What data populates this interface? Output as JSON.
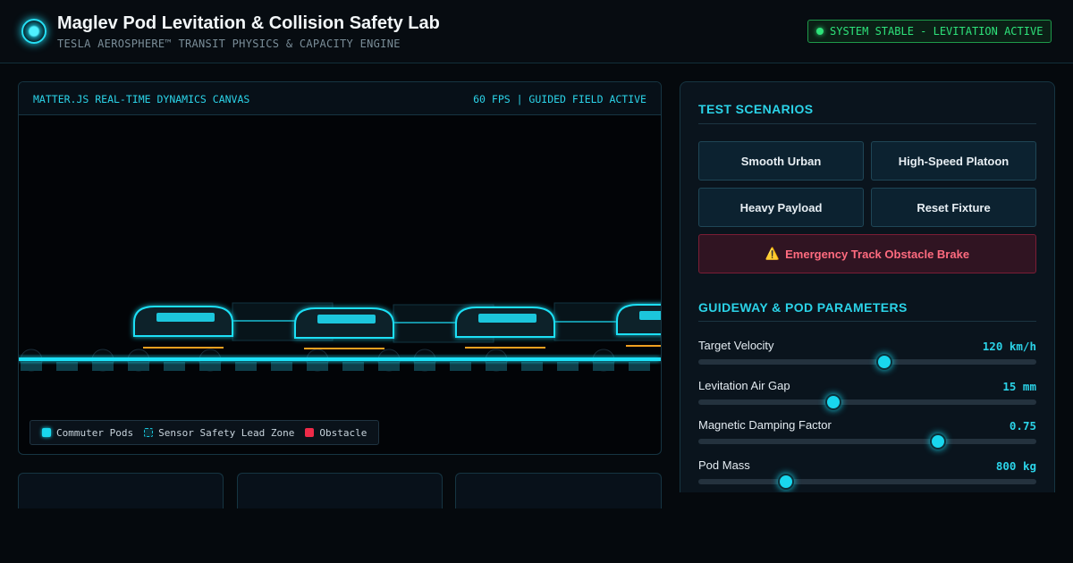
{
  "header": {
    "title": "Maglev Pod Levitation & Collision Safety Lab",
    "subtitle": "TESLA AEROSPHERE™ TRANSIT PHYSICS & CAPACITY ENGINE",
    "status": "SYSTEM STABLE - LEVITATION ACTIVE"
  },
  "canvas": {
    "title": "MATTER.JS REAL-TIME DYNAMICS CANVAS",
    "status": "60 FPS | GUIDED FIELD ACTIVE",
    "legend": {
      "pods": "Commuter Pods",
      "zone": "Sensor Safety Lead Zone",
      "obstacle": "Obstacle"
    }
  },
  "scenarios": {
    "title": "TEST SCENARIOS",
    "smooth_urban": "Smooth Urban",
    "high_speed": "High-Speed Platoon",
    "heavy_payload": "Heavy Payload",
    "reset": "Reset Fixture",
    "emergency": "Emergency Track Obstacle Brake"
  },
  "parameters": {
    "title": "GUIDEWAY & POD PARAMETERS",
    "items": [
      {
        "label": "Target Velocity",
        "value": "120 km/h",
        "level": 0.55
      },
      {
        "label": "Levitation Air Gap",
        "value": "15 mm",
        "level": 0.4
      },
      {
        "label": "Magnetic Damping Factor",
        "value": "0.75",
        "level": 0.71
      },
      {
        "label": "Pod Mass",
        "value": "800 kg",
        "level": 0.26
      }
    ]
  },
  "colors": {
    "accent": "#19d7ee",
    "status_ok": "#2ee27a",
    "danger": "#ff6b7f",
    "obstacle": "#ee2a48",
    "support_rail": "#f0a020"
  },
  "icons": {
    "logo": "glowing-orb-icon",
    "status": "status-dot-icon",
    "emergency": "warning-icon"
  }
}
